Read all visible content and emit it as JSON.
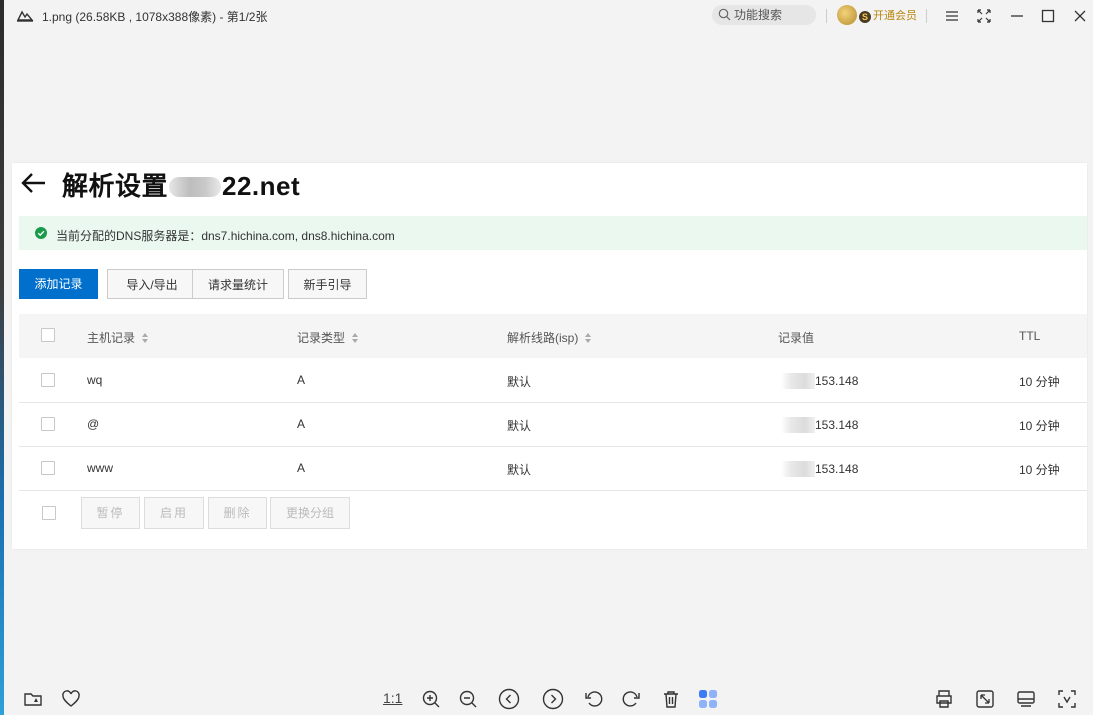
{
  "window": {
    "title": "1.png (26.58KB , 1078x388像素) - 第1/2张",
    "search_label": "功能搜索",
    "vip_label": "开通会员"
  },
  "page": {
    "title_prefix": "解析设置",
    "title_suffix": "22.net",
    "dns_notice": "当前分配的DNS服务器是：dns7.hichina.com, dns8.hichina.com"
  },
  "toolbar": {
    "add_record": "添加记录",
    "import_export": "导入/导出",
    "request_stats": "请求量统计",
    "beginner_guide": "新手引导"
  },
  "table": {
    "columns": [
      "主机记录",
      "记录类型",
      "解析线路(isp)",
      "记录值",
      "TTL"
    ],
    "rows": [
      {
        "host": "wq",
        "type": "A",
        "line": "默认",
        "value": "153.148",
        "ttl": "10 分钟"
      },
      {
        "host": "@",
        "type": "A",
        "line": "默认",
        "value": "153.148",
        "ttl": "10 分钟"
      },
      {
        "host": "www",
        "type": "A",
        "line": "默认",
        "value": "153.148",
        "ttl": "10 分钟"
      }
    ]
  },
  "batch": {
    "pause": "暂停",
    "enable": "启用",
    "delete": "删除",
    "change_group": "更换分组"
  },
  "viewer": {
    "ratio_label": "1:1"
  },
  "colors": {
    "primary": "#0070cc",
    "notice_bg": "#ebf8f0",
    "success": "#1a9b4b"
  }
}
